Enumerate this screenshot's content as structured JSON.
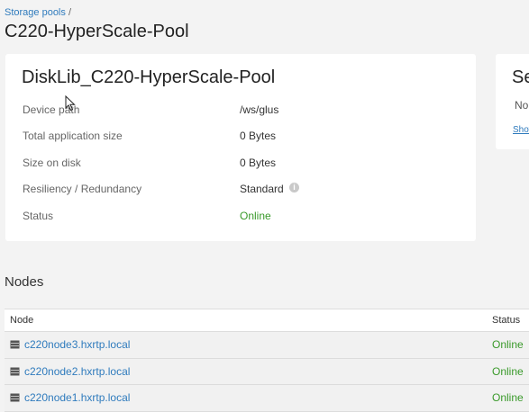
{
  "breadcrumb": {
    "link": "Storage pools",
    "separator": "/"
  },
  "page_title": "C220-HyperScale-Pool",
  "details": {
    "title": "DiskLib_C220-HyperScale-Pool",
    "properties": [
      {
        "label": "Device path",
        "value": "/ws/glus"
      },
      {
        "label": "Total application size",
        "value": "0 Bytes"
      },
      {
        "label": "Size on disk",
        "value": "0 Bytes"
      },
      {
        "label": "Resiliency / Redundancy",
        "value": "Standard"
      },
      {
        "label": "Status",
        "value": "Online"
      }
    ]
  },
  "side_card": {
    "title": "Se",
    "text": "No",
    "link": "Show"
  },
  "nodes": {
    "heading": "Nodes",
    "columns": [
      "Node",
      "Status"
    ],
    "rows": [
      {
        "name": "c220node3.hxrtp.local",
        "status": "Online"
      },
      {
        "name": "c220node2.hxrtp.local",
        "status": "Online"
      },
      {
        "name": "c220node1.hxrtp.local",
        "status": "Online"
      }
    ]
  },
  "colors": {
    "link": "#2f7bbd",
    "online": "#3a9a2b",
    "background": "#f3f3f3"
  },
  "icons": {
    "server": "server-icon",
    "info": "info-icon",
    "cursor": "mouse-cursor-icon"
  }
}
